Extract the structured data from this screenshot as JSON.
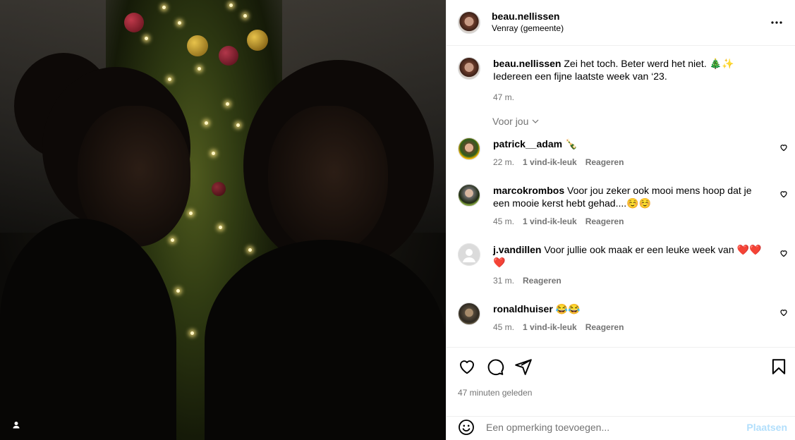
{
  "post": {
    "username": "beau.nellissen",
    "location": "Venray (gemeente)",
    "caption_user": "beau.nellissen",
    "caption_text": "Zei het toch. Beter werd het niet. 🎄✨ Iedereen een fijne laatste week van ‘23.",
    "caption_time": "47 m.",
    "for_you_label": "Voor jou"
  },
  "comments": [
    {
      "user": "patrick__adam",
      "text": "🍾",
      "time": "22 m.",
      "likes": "1 vind-ik-leuk",
      "reply": "Reageren"
    },
    {
      "user": "marcokrombos",
      "text": "Voor jou zeker ook mooi mens hoop dat je een mooie kerst hebt gehad....☺️☺️",
      "time": "45 m.",
      "likes": "1 vind-ik-leuk",
      "reply": "Reageren"
    },
    {
      "user": "j.vandillen",
      "text": "Voor jullie ook maak er een leuke week van ❤️❤️❤️",
      "time": "31 m.",
      "likes": "",
      "reply": "Reageren"
    },
    {
      "user": "ronaldhuiser",
      "text": "😂😂",
      "time": "45 m.",
      "likes": "1 vind-ik-leuk",
      "reply": "Reageren"
    }
  ],
  "footer": {
    "time_ago": "47 minuten geleden",
    "comment_placeholder": "Een opmerking toevoegen...",
    "post_label": "Plaatsen"
  },
  "icons": {
    "more": "more-options-icon",
    "like": "heart-icon",
    "comment": "comment-icon",
    "share": "send-icon",
    "save": "bookmark-icon",
    "emoji": "emoji-icon",
    "tagged": "user-tag-icon"
  },
  "colors": {
    "muted_text": "#737373",
    "post_button_disabled": "#b2dffc",
    "divider": "#efefef"
  }
}
